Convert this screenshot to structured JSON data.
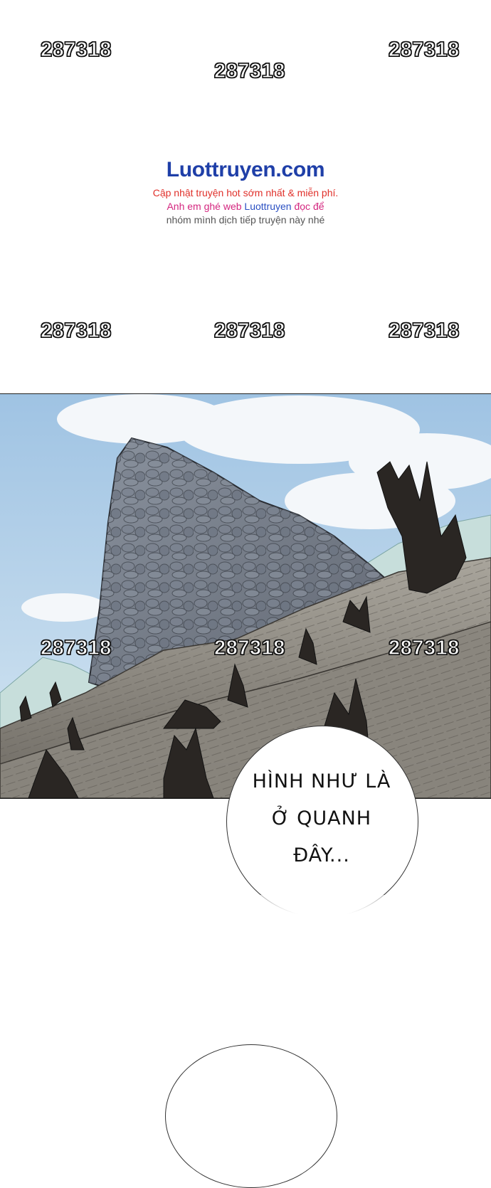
{
  "watermarks": {
    "top_left": "287318",
    "top_center": "287318",
    "top_right": "287318",
    "mid_left": "287318",
    "mid_center": "287318",
    "mid_right": "287318",
    "panel_left": "287318",
    "panel_center": "287318",
    "panel_right": "287318"
  },
  "brand": {
    "title": "Luottruyen.com",
    "line1": "Cập nhật truyện hot sớm nhất & miễn phí.",
    "line2_prefix": "Anh em ghé web ",
    "line2_highlight": "Luottruyen",
    "line2_suffix": " đọc để",
    "line3": "nhóm mình dịch tiếp truyện này nhé",
    "colors": {
      "title": "#1f3fa8",
      "line1": "#e0302a",
      "line2": "#d4267f",
      "highlight": "#2a4fc2",
      "line3": "#555555"
    }
  },
  "speech": {
    "line1": "HÌNH NHƯ LÀ",
    "line2": "Ở QUANH",
    "line3": "ĐÂY..."
  },
  "panel": {
    "scene": "rocky-mountain-dead-trees",
    "colors": {
      "sky": "#b9d4ea",
      "rock": "#7d8591",
      "ground": "#8f8b84",
      "trunk": "#2a2623"
    }
  }
}
